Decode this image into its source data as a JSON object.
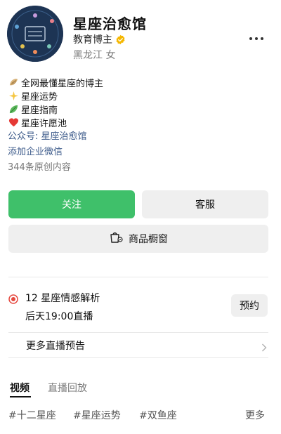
{
  "profile": {
    "name": "星座治愈馆",
    "role": "教育博主",
    "location": "黑龙江 女"
  },
  "bio": {
    "lines": [
      {
        "icon": "shell-icon",
        "text": "全网最懂星座的博主"
      },
      {
        "icon": "sparkle-icon",
        "text": "星座运势"
      },
      {
        "icon": "leaf-icon",
        "text": "星座指南"
      },
      {
        "icon": "heart-icon",
        "text": "星座许愿池"
      }
    ],
    "official_account": "公众号: 星座治愈馆",
    "wechat_link": "添加企业微信",
    "original_count": "344条原创内容"
  },
  "actions": {
    "follow": "关注",
    "service": "客服",
    "shop": "商品橱窗"
  },
  "live": {
    "title": "12 星座情感解析",
    "time": "后天19:00直播",
    "book": "预约",
    "more": "更多直播预告"
  },
  "tabs": {
    "video": "视频",
    "replay": "直播回放"
  },
  "tags": {
    "items": [
      "#十二星座",
      "#星座运势",
      "#双鱼座"
    ],
    "more": "更多"
  },
  "colors": {
    "accent_green": "#3fc06a",
    "link_blue": "#3c5a8a",
    "live_red": "#e5483f",
    "verified_gold": "#f5b700"
  }
}
